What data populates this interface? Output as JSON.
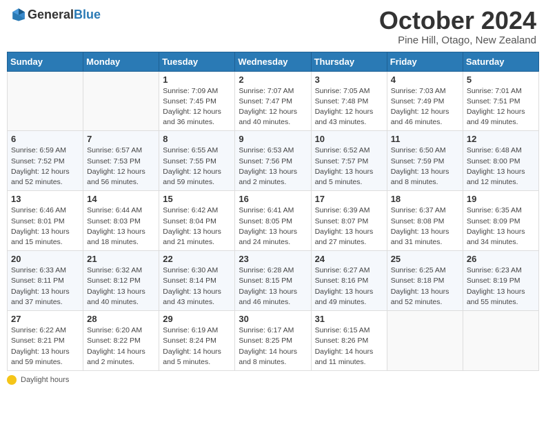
{
  "header": {
    "logo_general": "General",
    "logo_blue": "Blue",
    "month": "October 2024",
    "location": "Pine Hill, Otago, New Zealand"
  },
  "days_of_week": [
    "Sunday",
    "Monday",
    "Tuesday",
    "Wednesday",
    "Thursday",
    "Friday",
    "Saturday"
  ],
  "weeks": [
    [
      {
        "day": "",
        "info": ""
      },
      {
        "day": "",
        "info": ""
      },
      {
        "day": "1",
        "info": "Sunrise: 7:09 AM\nSunset: 7:45 PM\nDaylight: 12 hours and 36 minutes."
      },
      {
        "day": "2",
        "info": "Sunrise: 7:07 AM\nSunset: 7:47 PM\nDaylight: 12 hours and 40 minutes."
      },
      {
        "day": "3",
        "info": "Sunrise: 7:05 AM\nSunset: 7:48 PM\nDaylight: 12 hours and 43 minutes."
      },
      {
        "day": "4",
        "info": "Sunrise: 7:03 AM\nSunset: 7:49 PM\nDaylight: 12 hours and 46 minutes."
      },
      {
        "day": "5",
        "info": "Sunrise: 7:01 AM\nSunset: 7:51 PM\nDaylight: 12 hours and 49 minutes."
      }
    ],
    [
      {
        "day": "6",
        "info": "Sunrise: 6:59 AM\nSunset: 7:52 PM\nDaylight: 12 hours and 52 minutes."
      },
      {
        "day": "7",
        "info": "Sunrise: 6:57 AM\nSunset: 7:53 PM\nDaylight: 12 hours and 56 minutes."
      },
      {
        "day": "8",
        "info": "Sunrise: 6:55 AM\nSunset: 7:55 PM\nDaylight: 12 hours and 59 minutes."
      },
      {
        "day": "9",
        "info": "Sunrise: 6:53 AM\nSunset: 7:56 PM\nDaylight: 13 hours and 2 minutes."
      },
      {
        "day": "10",
        "info": "Sunrise: 6:52 AM\nSunset: 7:57 PM\nDaylight: 13 hours and 5 minutes."
      },
      {
        "day": "11",
        "info": "Sunrise: 6:50 AM\nSunset: 7:59 PM\nDaylight: 13 hours and 8 minutes."
      },
      {
        "day": "12",
        "info": "Sunrise: 6:48 AM\nSunset: 8:00 PM\nDaylight: 13 hours and 12 minutes."
      }
    ],
    [
      {
        "day": "13",
        "info": "Sunrise: 6:46 AM\nSunset: 8:01 PM\nDaylight: 13 hours and 15 minutes."
      },
      {
        "day": "14",
        "info": "Sunrise: 6:44 AM\nSunset: 8:03 PM\nDaylight: 13 hours and 18 minutes."
      },
      {
        "day": "15",
        "info": "Sunrise: 6:42 AM\nSunset: 8:04 PM\nDaylight: 13 hours and 21 minutes."
      },
      {
        "day": "16",
        "info": "Sunrise: 6:41 AM\nSunset: 8:05 PM\nDaylight: 13 hours and 24 minutes."
      },
      {
        "day": "17",
        "info": "Sunrise: 6:39 AM\nSunset: 8:07 PM\nDaylight: 13 hours and 27 minutes."
      },
      {
        "day": "18",
        "info": "Sunrise: 6:37 AM\nSunset: 8:08 PM\nDaylight: 13 hours and 31 minutes."
      },
      {
        "day": "19",
        "info": "Sunrise: 6:35 AM\nSunset: 8:09 PM\nDaylight: 13 hours and 34 minutes."
      }
    ],
    [
      {
        "day": "20",
        "info": "Sunrise: 6:33 AM\nSunset: 8:11 PM\nDaylight: 13 hours and 37 minutes."
      },
      {
        "day": "21",
        "info": "Sunrise: 6:32 AM\nSunset: 8:12 PM\nDaylight: 13 hours and 40 minutes."
      },
      {
        "day": "22",
        "info": "Sunrise: 6:30 AM\nSunset: 8:14 PM\nDaylight: 13 hours and 43 minutes."
      },
      {
        "day": "23",
        "info": "Sunrise: 6:28 AM\nSunset: 8:15 PM\nDaylight: 13 hours and 46 minutes."
      },
      {
        "day": "24",
        "info": "Sunrise: 6:27 AM\nSunset: 8:16 PM\nDaylight: 13 hours and 49 minutes."
      },
      {
        "day": "25",
        "info": "Sunrise: 6:25 AM\nSunset: 8:18 PM\nDaylight: 13 hours and 52 minutes."
      },
      {
        "day": "26",
        "info": "Sunrise: 6:23 AM\nSunset: 8:19 PM\nDaylight: 13 hours and 55 minutes."
      }
    ],
    [
      {
        "day": "27",
        "info": "Sunrise: 6:22 AM\nSunset: 8:21 PM\nDaylight: 13 hours and 59 minutes."
      },
      {
        "day": "28",
        "info": "Sunrise: 6:20 AM\nSunset: 8:22 PM\nDaylight: 14 hours and 2 minutes."
      },
      {
        "day": "29",
        "info": "Sunrise: 6:19 AM\nSunset: 8:24 PM\nDaylight: 14 hours and 5 minutes."
      },
      {
        "day": "30",
        "info": "Sunrise: 6:17 AM\nSunset: 8:25 PM\nDaylight: 14 hours and 8 minutes."
      },
      {
        "day": "31",
        "info": "Sunrise: 6:15 AM\nSunset: 8:26 PM\nDaylight: 14 hours and 11 minutes."
      },
      {
        "day": "",
        "info": ""
      },
      {
        "day": "",
        "info": ""
      }
    ]
  ],
  "footer": {
    "icon_label": "sun-icon",
    "label": "Daylight hours"
  }
}
